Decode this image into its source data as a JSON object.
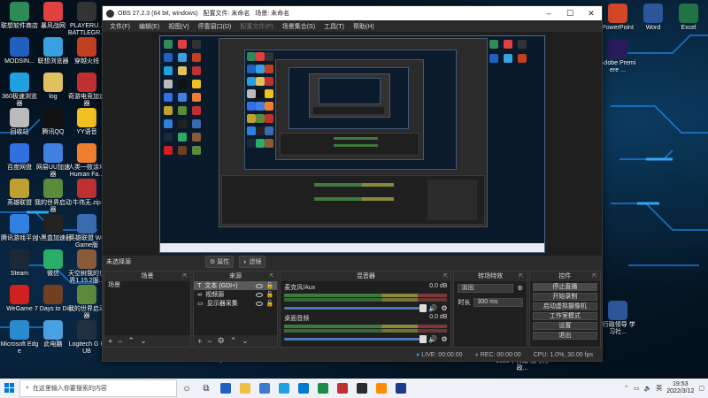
{
  "desktop": {
    "left_icons": [
      {
        "label": "联想软件商店",
        "color": "#2e8b57"
      },
      {
        "label": "暴风战网",
        "color": "#e04040"
      },
      {
        "label": "PLAYERU... BATTLEGR...",
        "color": "#333333"
      },
      {
        "label": "MODSIN...",
        "color": "#2060c0"
      },
      {
        "label": "联想浏览器",
        "color": "#3aa0e0"
      },
      {
        "label": "穿越火线",
        "color": "#c04020"
      },
      {
        "label": "360极速浏览器",
        "color": "#20a0e0"
      },
      {
        "label": "log",
        "color": "#e0c060"
      },
      {
        "label": "奇游电竞加速器",
        "color": "#c03030"
      },
      {
        "label": "回收站",
        "color": "#bbbbbb"
      },
      {
        "label": "腾讯QQ",
        "color": "#111111"
      },
      {
        "label": "YY语音",
        "color": "#f0c020"
      },
      {
        "label": "百度网盘",
        "color": "#3070e0"
      },
      {
        "label": "网易UU加速器",
        "color": "#4080e0"
      },
      {
        "label": "人类一败涂地 Human Fa...",
        "color": "#f08030"
      },
      {
        "label": "英雄联盟",
        "color": "#c0a030"
      },
      {
        "label": "我的世界启动器",
        "color": "#5a8a3a"
      },
      {
        "label": "牛伟无.zip",
        "color": "#c03030"
      },
      {
        "label": "腾讯游戏平台",
        "color": "#3080e0"
      },
      {
        "label": "小黑盒加速器",
        "color": "#222222"
      },
      {
        "label": "英雄联盟 WeGame版",
        "color": "#3a6ab0"
      },
      {
        "label": "Steam",
        "color": "#1b2838"
      },
      {
        "label": "微信",
        "color": "#2aae67"
      },
      {
        "label": "天空树我的世界1.15.2服...",
        "color": "#8a5a3a"
      },
      {
        "label": "WeGame",
        "color": "#d02020"
      },
      {
        "label": "7 Days to Die",
        "color": "#704020"
      },
      {
        "label": "我的世界启动器",
        "color": "#5a8a3a"
      },
      {
        "label": "Microsoft Edge",
        "color": "#2a8ad0"
      },
      {
        "label": "此电脑",
        "color": "#4aa0e0"
      },
      {
        "label": "Logitech G HUB",
        "color": "#203040"
      }
    ],
    "bottom_labels": [
      "OBS Studio",
      "TFTactics",
      "mmexport..."
    ],
    "right_icons": [
      {
        "label": "PowerPoint",
        "color": "#d24726"
      },
      {
        "label": "Word",
        "color": "#2b579a"
      },
      {
        "label": "Excel",
        "color": "#217346"
      },
      {
        "label": "Adobe Premiere ...",
        "color": "#2a1a5a"
      },
      {
        "label": "\"行政领导 学习社...",
        "color": "#2b579a"
      }
    ],
    "notify_text": "2021年行政 法与行政...",
    "wallpaper_accent": "#1e90ff"
  },
  "obs": {
    "title": "OBS 27.2.3 (64 bit, windows)",
    "profile": "配置文件: 未命名",
    "scene_collection": "场景: 未命名",
    "menu": [
      "文件(F)",
      "编辑(E)",
      "视图(V)",
      "停靠窗口(D)",
      "配置文件(P)",
      "场景集合(S)",
      "工具(T)",
      "帮助(H)"
    ],
    "no_source": "未选择源",
    "props_btn": "属性",
    "filters_btn": "滤镜",
    "docks": {
      "scenes_title": "场景",
      "scenes": [
        "场景"
      ],
      "sources_title": "来源",
      "sources": [
        "文本 (GDI+)",
        "视频源",
        "显示器采集"
      ],
      "mixer_title": "混音器",
      "mixer": [
        {
          "name": "麦克风/Aux",
          "db": "0.0 dB"
        },
        {
          "name": "桌面音频",
          "db": "0.0 dB"
        }
      ],
      "transitions_title": "转场特效",
      "transition": "淡出",
      "duration_label": "时长",
      "duration": "300 ms",
      "controls_title": "控件",
      "controls": [
        "停止直播",
        "开始录制",
        "启动虚拟摄像机",
        "工作室模式",
        "设置",
        "退出"
      ]
    },
    "status": {
      "live": "LIVE: 00:00:00",
      "rec": "REC: 00:00:00",
      "cpu": "CPU: 1.0%, 30.00 fps"
    }
  },
  "taskbar": {
    "search_placeholder": "在这里输入你要搜索的内容",
    "apps": [
      "#2060c0",
      "#f0c040",
      "#3a7ad0",
      "#20a0e0",
      "#0078d4",
      "#1e8a4a",
      "#c03030",
      "#2a2a2a",
      "#ff8c00",
      "#1e3a8a"
    ],
    "time": "19:53",
    "date": "2022/3/12"
  }
}
